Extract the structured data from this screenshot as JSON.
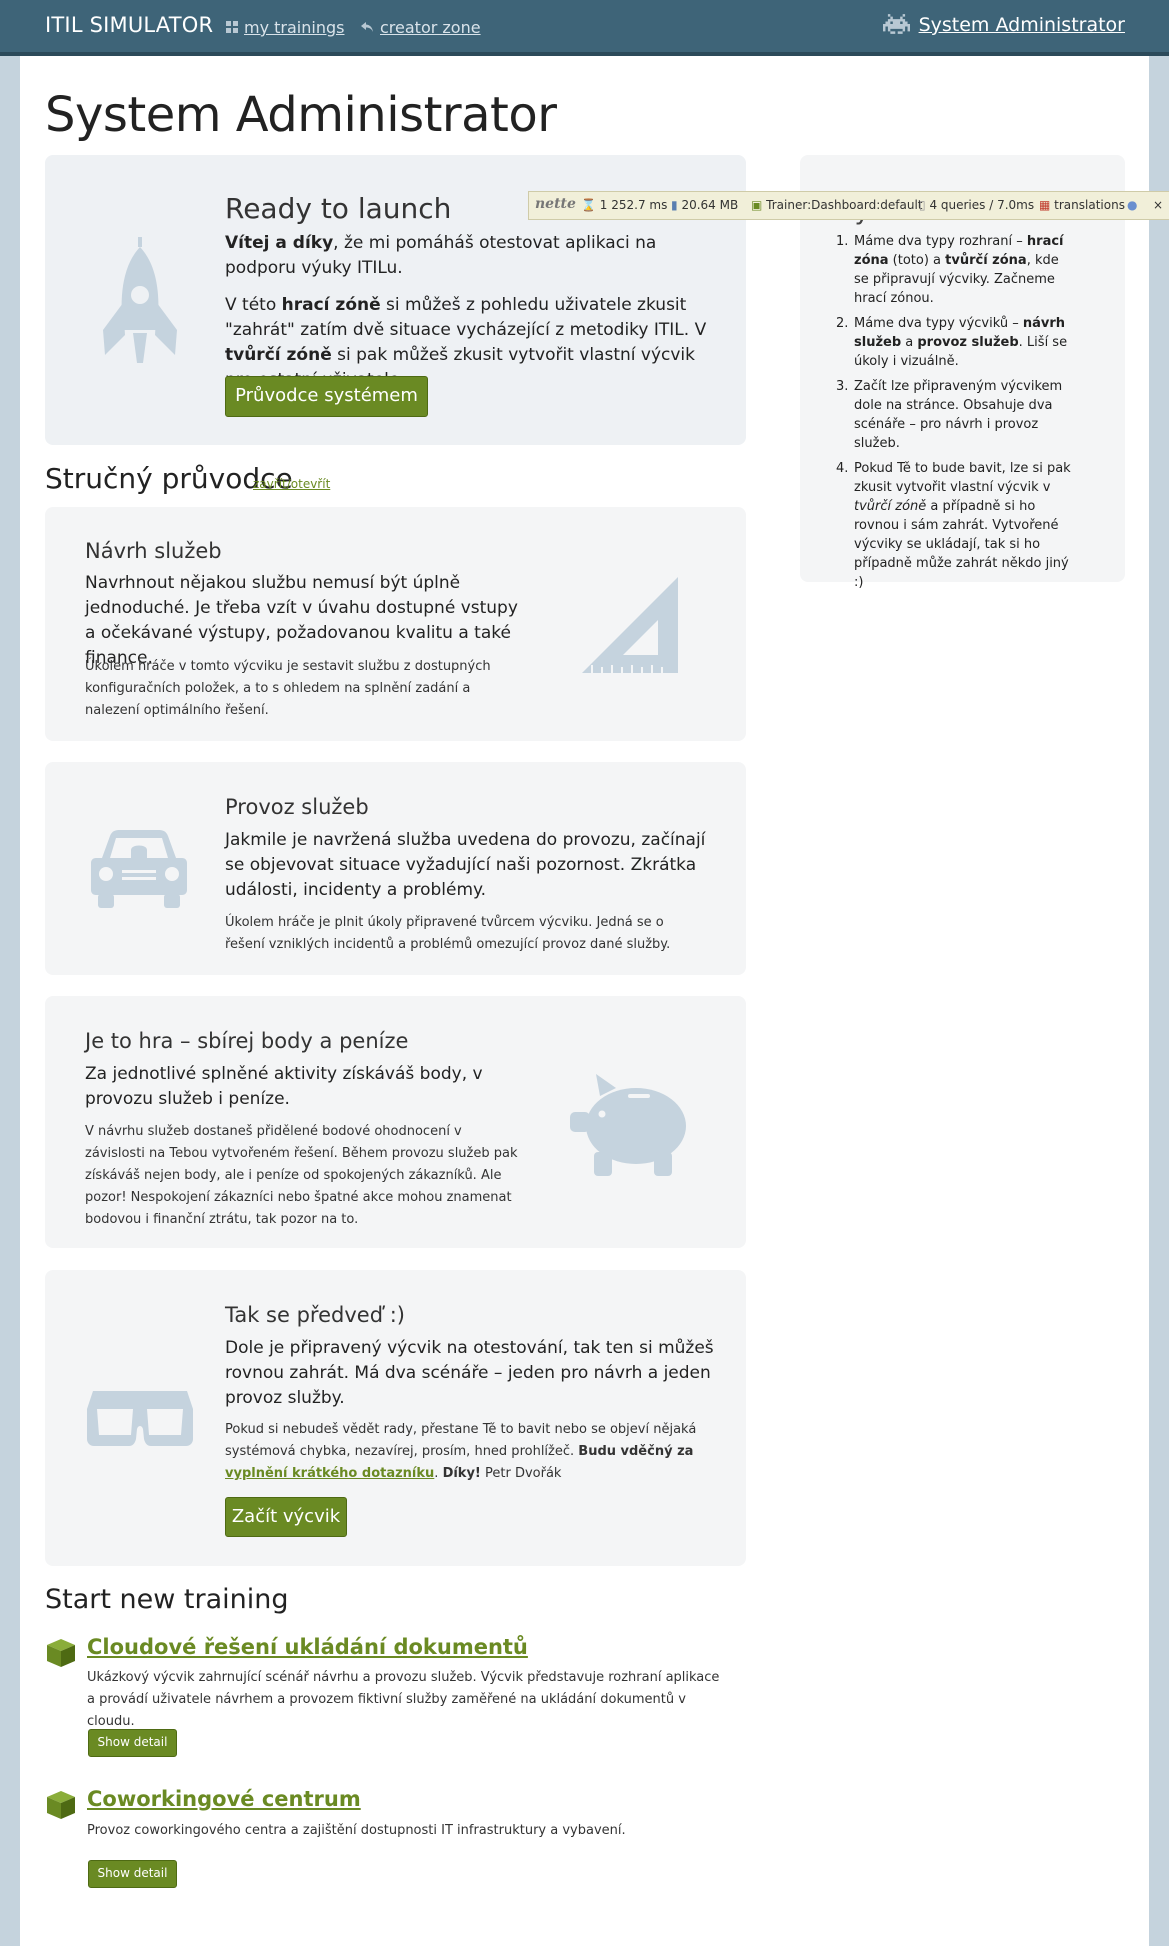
{
  "navbar": {
    "brand": "ITIL SIMULATOR",
    "links": [
      {
        "label": "my trainings",
        "icon": "grid-icon"
      },
      {
        "label": "creator zone",
        "icon": "reply-icon"
      }
    ],
    "user": "System Administrator",
    "user_icon": "space-invader-icon"
  },
  "page_title": "System Administrator",
  "launch": {
    "title": "Ready to launch",
    "p1_bold": "Vítej a díky",
    "p1_rest": ", že mi pomáháš otestovat aplikaci na podporu výuky ITILu.",
    "p2_a": "V této ",
    "p2_b": "hrací zóně",
    "p2_c": " si můžeš z pohledu uživatele zkusit \"zahrát\" zatím dvě situace vycházející z metodiky ITIL. V ",
    "p2_d": "tvůrčí zóně",
    "p2_e": " si pak můžeš zkusit vytvořit vlastní výcvik pro ostatní uživatele.",
    "button": "Průvodce systémem",
    "icon": "rocket-icon"
  },
  "guide": {
    "title": "Stručný průvodce",
    "toggle": "zavřít/otevřít",
    "sections": [
      {
        "title": "Návrh služeb",
        "lead": "Navrhnout nějakou službu nemusí být úplně jednoduché. Je třeba vzít v úvahu dostupné vstupy a očekávané výstupy, požadovanou kvalitu a také finance.",
        "text": "Úkolem hráče v tomto výcviku je sestavit službu z dostupných konfiguračních položek, a to s ohledem na splnění zadání a nalezení optimálního řešení.",
        "icon": "set-square-icon"
      },
      {
        "title": "Provoz služeb",
        "lead": "Jakmile je navržená služba uvedena do provozu, začínají se objevovat situace vyžadující naši pozornost. Zkrátka události, incidenty a problémy.",
        "text": "Úkolem hráče je plnit úkoly připravené tvůrcem výcviku. Jedná se o řešení vzniklých incidentů a problémů omezující provoz dané služby.",
        "icon": "car-icon"
      },
      {
        "title": "Je to hra – sbírej body a peníze",
        "lead": "Za jednotlivé splněné aktivity získáváš body, v provozu služeb i peníze.",
        "text": "V návrhu služeb dostaneš přidělené bodové ohodnocení v závislosti na Tebou vytvořeném řešení. Během provozu služeb pak získáváš nejen body, ale i peníze od spokojených zákazníků. Ale pozor! Nespokojení zákazníci nebo špatné akce mohou znamenat bodovou i finanční ztrátu, tak pozor na to.",
        "icon": "piggy-bank-icon"
      },
      {
        "title": "Tak se předveď :)",
        "lead": "Dole je připravený výcvik na otestování, tak ten si můžeš rovnou zahrát. Má dva scénáře – jeden pro návrh a jeden provoz služby.",
        "text_a": "Pokud si nebudeš vědět rady, přestane Tě to bavit nebo se objeví nějaká systémová chybka, nezavírej, prosím, hned prohlížeč. ",
        "text_b": "Budu vděčný za ",
        "text_link": "vyplnění krátkého dotazníku",
        "text_c": ". ",
        "text_d": "Díky!",
        "text_e": " Petr Dvořák",
        "button": "Začít výcvik",
        "icon": "3d-glasses-icon"
      }
    ]
  },
  "trainings": {
    "title": "Start new training",
    "items": [
      {
        "name": "Cloudové řešení ukládání dokumentů",
        "description": "Ukázkový výcvik zahrnující scénář návrhu a provozu služeb. Výcvik představuje rozhraní aplikace a provádí uživatele návrhem a provozem fiktivní služby zaměřené na ukládání dokumentů v cloudu.",
        "button": "Show detail",
        "icon": "cube-icon"
      },
      {
        "name": "Coworkingové centrum",
        "description": "Provoz coworkingového centra a zajištění dostupnosti IT infrastruktury a vybavení.",
        "button": "Show detail",
        "icon": "cube-icon"
      }
    ]
  },
  "sidebar": {
    "title": "Systém v kostce",
    "items": [
      {
        "num": "1.",
        "a": "Máme dva typy rozhraní – ",
        "b": "hrací zóna",
        "c": " (toto) a ",
        "d": "tvůrčí zóna",
        "e": ", kde se připravují výcviky. Začneme hrací zónou."
      },
      {
        "num": "2.",
        "a": "Máme dva typy výcviků – ",
        "b": "návrh služeb",
        "c": " a ",
        "d": "provoz služeb",
        "e": ". Liší se úkoly i vizuálně."
      },
      {
        "num": "3.",
        "a": "Začít lze připraveným výcvikem dole na stránce. Obsahuje dva scénáře – pro návrh i provoz služeb."
      },
      {
        "num": "4.",
        "a": "Pokud Tě to bude bavit, lze si pak zkusit vytvořit vlastní výcvik v ",
        "b": "tvůrčí zóně",
        "c": " a případně si ho rovnou i sám zahrát. Vytvořené výcviky se ukládají, tak si ho případně může zahrát někdo jiný :)"
      }
    ]
  },
  "debugbar": {
    "logo": "nette",
    "time": "1 252.7 ms",
    "memory": "20.64 MB",
    "presenter": "Trainer:Dashboard:default",
    "queries": "4 queries / 7.0ms",
    "translations": "translations",
    "close": "×"
  },
  "colors": {
    "navbar": "#3e6478",
    "accent_green": "#6a8a23",
    "icon_blue": "#c5d3de",
    "well": "#f4f5f6",
    "page_bg": "#c5d3dd"
  }
}
